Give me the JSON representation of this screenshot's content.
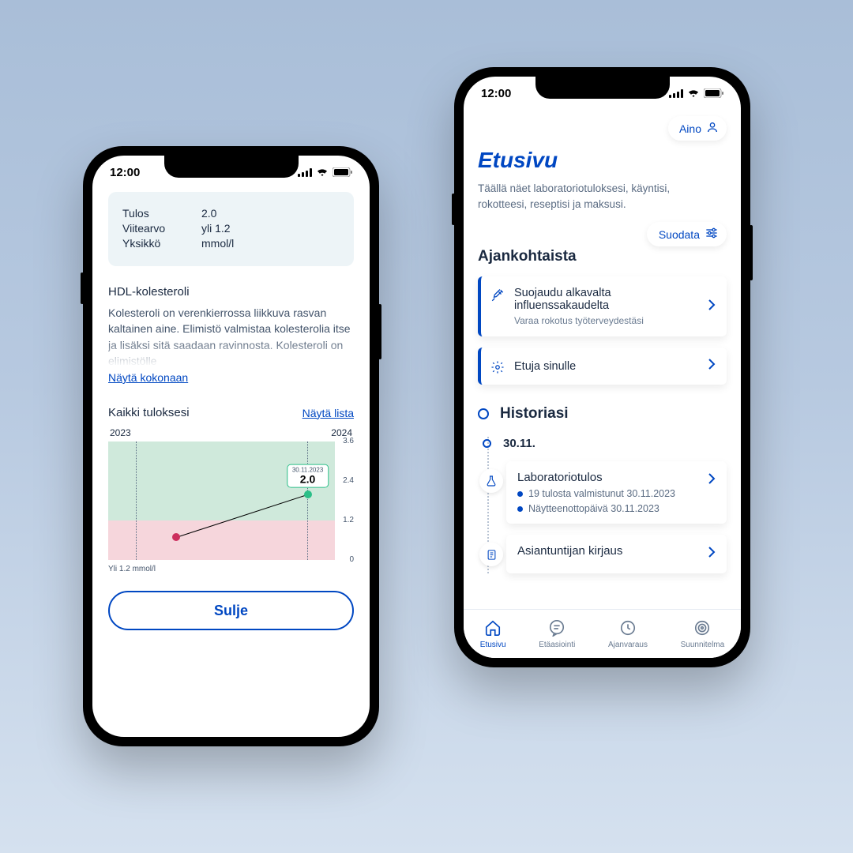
{
  "common": {
    "time": "12:00"
  },
  "phoneA": {
    "info": {
      "rows": [
        {
          "k": "Tulos",
          "v": "2.0"
        },
        {
          "k": "Viitearvo",
          "v": "yli 1.2"
        },
        {
          "k": "Yksikkö",
          "v": "mmol/l"
        }
      ]
    },
    "section": {
      "title": "HDL-kolesteroli",
      "body": "Kolesteroli on verenkierrossa liikkuva rasvan kaltainen aine. Elimistö valmistaa kolesterolia itse ja lisäksi sitä saadaan ravinnosta. Kolesteroli on elimistölle",
      "expand": "Näytä kokonaan"
    },
    "results": {
      "title": "Kaikki tuloksesi",
      "link": "Näytä lista"
    },
    "chart_footnote": "Yli 1.2 mmol/l",
    "close": "Sulje"
  },
  "chart_data": {
    "type": "line",
    "title": "Kaikki tuloksesi",
    "x_labels": [
      "2023",
      "2024"
    ],
    "y_ticks": [
      0,
      1.2,
      2.4,
      3.6
    ],
    "ylim": [
      0,
      3.6
    ],
    "reference_threshold": 1.2,
    "zones": [
      {
        "name": "above_ref",
        "range": [
          1.2,
          3.6
        ],
        "color": "#cfe9db"
      },
      {
        "name": "below_ref",
        "range": [
          0,
          1.2
        ],
        "color": "#f6d6dc"
      }
    ],
    "points": [
      {
        "x_label": "2023",
        "x": 0.3,
        "y": 0.7,
        "color": "#cc2e5d"
      },
      {
        "x_label": "2024",
        "x": 0.88,
        "y": 2.0,
        "color": "#2bbf88",
        "callout": {
          "date": "30.11.2023",
          "value": "2.0"
        }
      }
    ],
    "unit": "mmol/l"
  },
  "phoneB": {
    "user": "Aino",
    "title": "Etusivu",
    "subtitle": "Täällä näet laboratoriotuloksesi, käyntisi, rokotteesi, reseptisi ja maksusi.",
    "filter": "Suodata",
    "section_current": "Ajankohtaista",
    "cards": [
      {
        "title": "Suojaudu alkavalta influenssakaudelta",
        "meta": "Varaa rokotus työterveydestäsi",
        "icon": "syringe"
      },
      {
        "title": "Etuja sinulle",
        "meta": "",
        "icon": "gear"
      }
    ],
    "history": {
      "title": "Historiasi",
      "date": "30.11.",
      "entries": [
        {
          "kind": "lab",
          "title": "Laboratoriotulos",
          "rows": [
            "19 tulosta valmistunut 30.11.2023",
            "Näytteenottopäivä 30.11.2023"
          ]
        },
        {
          "kind": "note",
          "title": "Asiantuntijan kirjaus",
          "rows": []
        }
      ]
    },
    "tabs": [
      {
        "label": "Etusivu",
        "icon": "home",
        "active": true
      },
      {
        "label": "Etäasiointi",
        "icon": "chat",
        "active": false
      },
      {
        "label": "Ajanvaraus",
        "icon": "clock",
        "active": false
      },
      {
        "label": "Suunnitelma",
        "icon": "target",
        "active": false
      }
    ]
  }
}
